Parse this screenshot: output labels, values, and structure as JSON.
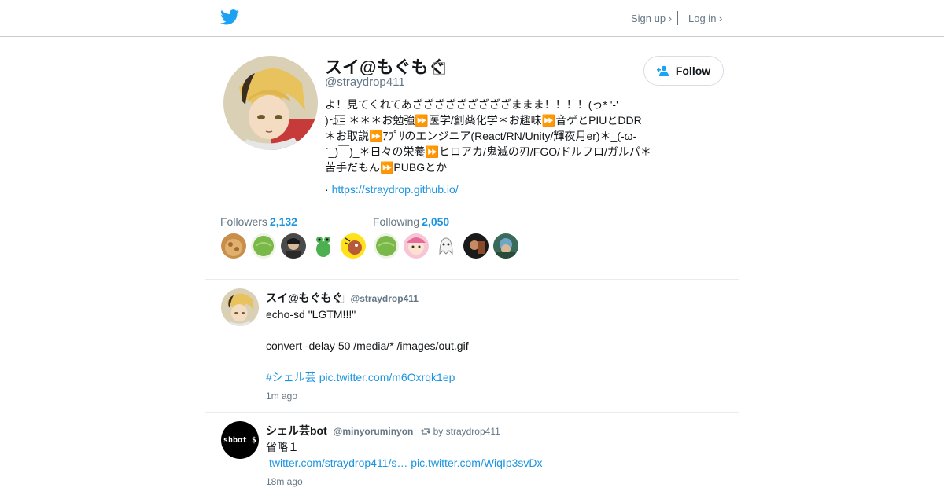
{
  "header": {
    "signup": "Sign up ›",
    "login": "Log in ›",
    "logo_icon": "twitter-bird-icon"
  },
  "colors": {
    "brand": "#1da1f2",
    "link": "#1b95e0",
    "muted": "#657786"
  },
  "profile": {
    "name": "スイ@もぐもぐ",
    "name_suffix": "⃞",
    "handle": "@straydrop411",
    "follow_label": "Follow",
    "bio_lines": [
      "よ！見てくれてあざざざざざざざざざままま！！！！(っ* '-'",
      ")っ=⃞ ＊＊＊お勉強⏩医学/創薬化学＊お趣味⏩音ゲとPIUとDDR",
      "＊お取説⏩ｱﾌﾟﾘのエンジニア(React/RN/Unity/輝夜月er)＊_(-ω-",
      "`_)￣)_＊日々の栄養⏩ヒロアカ/鬼滅の刃/FGO/ドルフロ/ガルパ＊",
      "苦手だもん⏩PUBGとか"
    ],
    "website_prefix": "·",
    "website": "https://straydrop.github.io/"
  },
  "stats": {
    "followers_label": "Followers",
    "followers_count": "2,132",
    "following_label": "Following",
    "following_count": "2,050"
  },
  "tweets": [
    {
      "name": "スイ@もぐもぐ",
      "name_suffix": "⃞",
      "handle": "@straydrop411",
      "line1": "echo-sd \"LGTM!!!\"",
      "line2": "convert -delay 50 /media/* /images/out.gif",
      "hashtag": "#シェル芸",
      "link": "pic.twitter.com/m6Oxrqk1ep",
      "time": "1m ago"
    },
    {
      "name": "シェル芸bot",
      "handle": "@minyoruminyon",
      "retweet_by": "by straydrop411",
      "avatar_text": "shbot $",
      "line1": "省略１",
      "link1": "twitter.com/straydrop411/s…",
      "link2": "pic.twitter.com/WiqIp3svDx",
      "time": "18m ago"
    }
  ]
}
